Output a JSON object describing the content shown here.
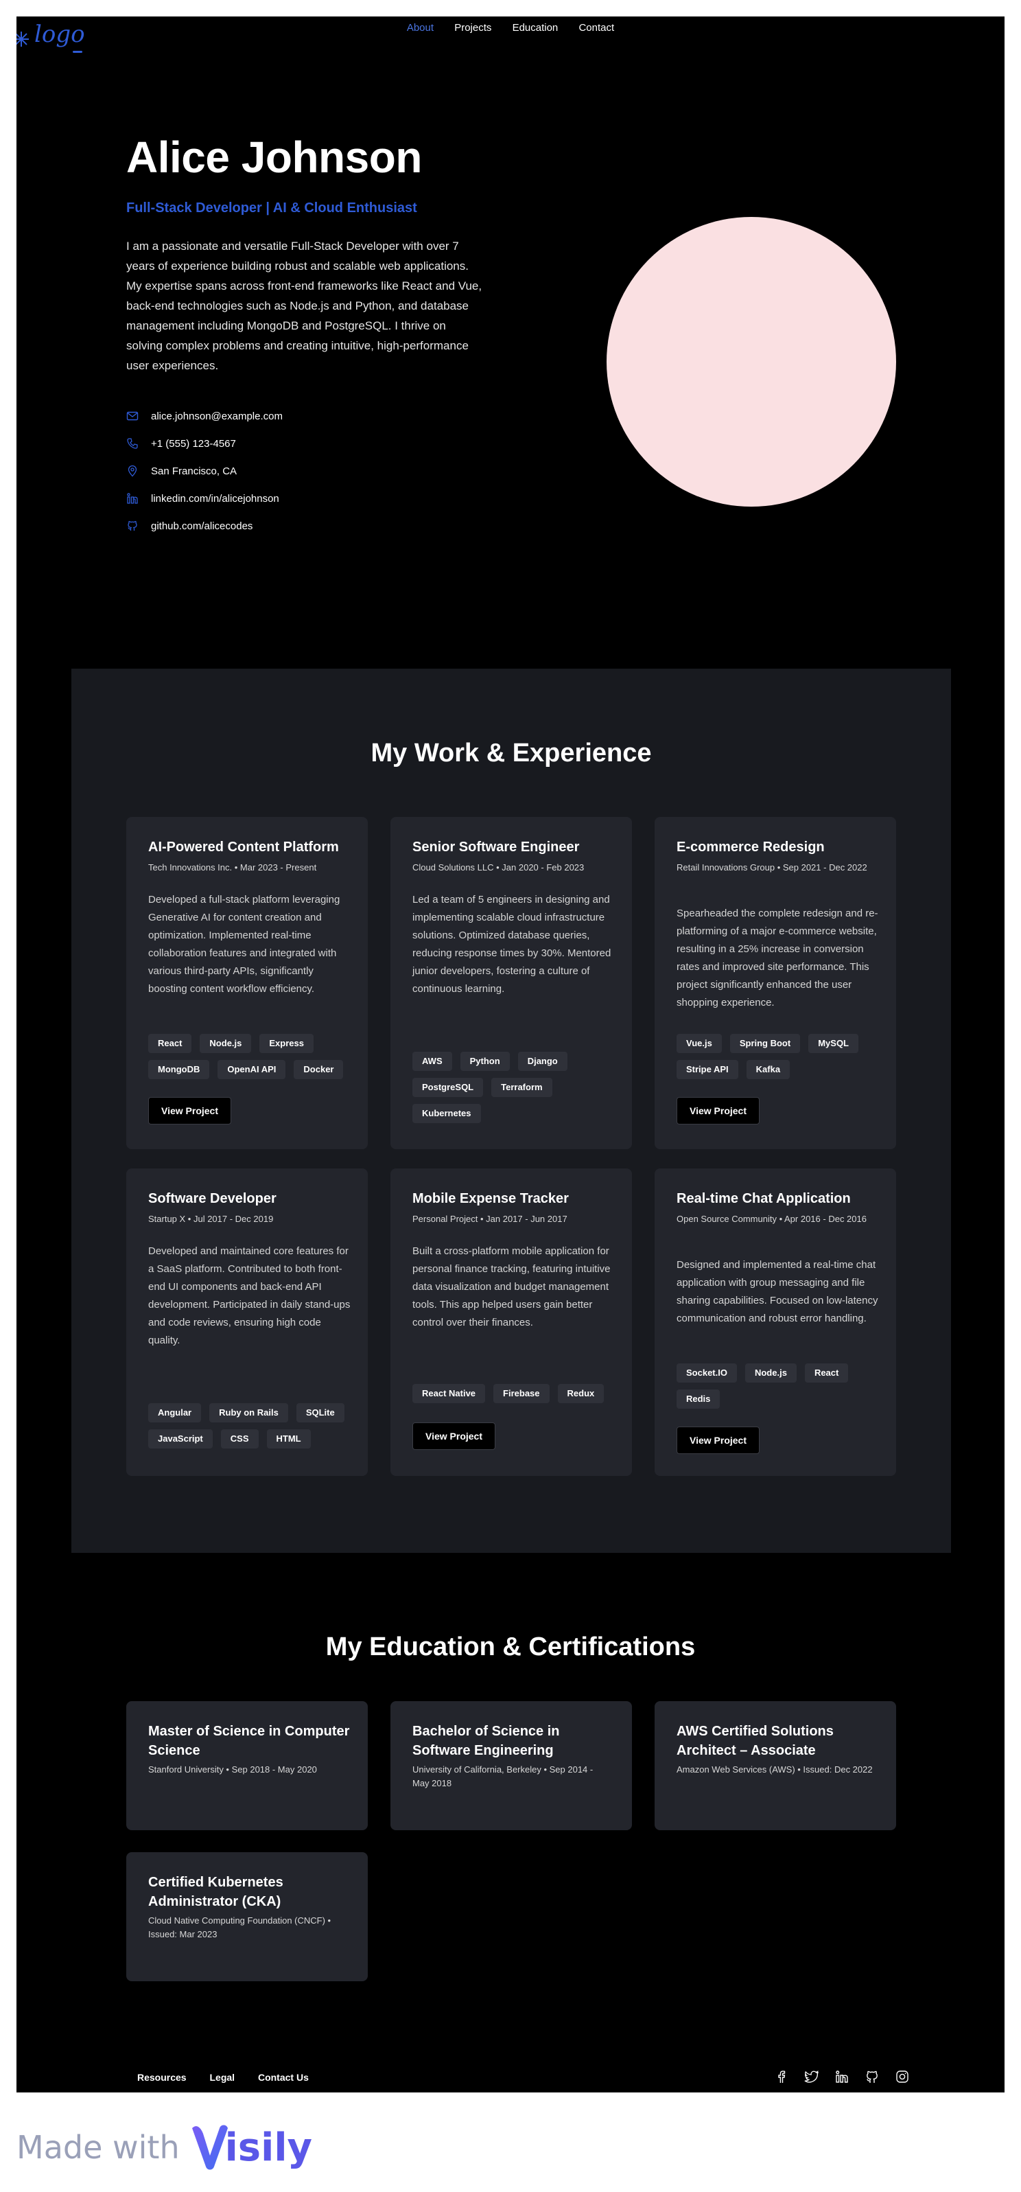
{
  "brand": {
    "logo_text": "logo",
    "logo_color": "#2f5bd6"
  },
  "nav": [
    {
      "label": "About",
      "active": true
    },
    {
      "label": "Projects",
      "active": false
    },
    {
      "label": "Education",
      "active": false
    },
    {
      "label": "Contact",
      "active": false
    }
  ],
  "hero": {
    "name": "Alice Johnson",
    "role": "Full-Stack Developer | AI & Cloud Enthusiast",
    "bio": "I am a passionate and versatile Full-Stack Developer with over 7 years of experience building robust and scalable web applications. My expertise spans across front-end frameworks like React and Vue, back-end technologies such as Node.js and Python, and database management including MongoDB and PostgreSQL. I thrive on solving complex problems and creating intuitive, high-performance user experiences.",
    "contacts": [
      {
        "icon": "mail-icon",
        "text": "alice.johnson@example.com"
      },
      {
        "icon": "phone-icon",
        "text": "+1 (555) 123-4567"
      },
      {
        "icon": "map-pin-icon",
        "text": "San Francisco, CA"
      },
      {
        "icon": "linkedin-icon",
        "text": "linkedin.com/in/alicejohnson"
      },
      {
        "icon": "github-icon",
        "text": "github.com/alicecodes"
      }
    ],
    "avatar_color": "#fae0e2"
  },
  "work": {
    "title": "My Work & Experience",
    "cards": [
      {
        "title": "AI-Powered Content Platform",
        "meta": "Tech Innovations Inc. • Mar 2023 - Present",
        "desc": "Developed a full-stack platform leveraging Generative AI for content creation and optimization. Implemented real-time collaboration features and integrated with various third-party APIs, significantly boosting content workflow efficiency.",
        "tags": [
          "React",
          "Node.js",
          "Express",
          "MongoDB",
          "OpenAI API",
          "Docker"
        ],
        "button": "View Project"
      },
      {
        "title": "Senior Software Engineer",
        "meta": "Cloud Solutions LLC • Jan 2020 - Feb 2023",
        "desc": "Led a team of 5 engineers in designing and implementing scalable cloud infrastructure solutions. Optimized database queries, reducing response times by 30%. Mentored junior developers, fostering a culture of continuous learning.",
        "tags": [
          "AWS",
          "Python",
          "Django",
          "PostgreSQL",
          "Terraform",
          "Kubernetes"
        ],
        "button": ""
      },
      {
        "title": "E-commerce Redesign",
        "meta": "Retail Innovations Group • Sep 2021 - Dec 2022",
        "desc": "Spearheaded the complete redesign and re-platforming of a major e-commerce website, resulting in a 25% increase in conversion rates and improved site performance. This project significantly enhanced the user shopping experience.",
        "tags": [
          "Vue.js",
          "Spring Boot",
          "MySQL",
          "Stripe API",
          "Kafka"
        ],
        "button": "View Project"
      },
      {
        "title": "Software Developer",
        "meta": "Startup X • Jul 2017 - Dec 2019",
        "desc": "Developed and maintained core features for a SaaS platform. Contributed to both front-end UI components and back-end API development. Participated in daily stand-ups and code reviews, ensuring high code quality.",
        "tags": [
          "Angular",
          "Ruby on Rails",
          "SQLite",
          "JavaScript",
          "CSS",
          "HTML"
        ],
        "button": ""
      },
      {
        "title": "Mobile Expense Tracker",
        "meta": "Personal Project • Jan 2017 - Jun 2017",
        "desc": "Built a cross-platform mobile application for personal finance tracking, featuring intuitive data visualization and budget management tools. This app helped users gain better control over their finances.",
        "tags": [
          "React Native",
          "Firebase",
          "Redux"
        ],
        "button": "View Project"
      },
      {
        "title": "Real-time Chat Application",
        "meta": "Open Source Community • Apr 2016 - Dec 2016",
        "desc": "Designed and implemented a real-time chat application with group messaging and file sharing capabilities. Focused on low-latency communication and robust error handling.",
        "tags": [
          "Socket.IO",
          "Node.js",
          "React",
          "Redis"
        ],
        "button": "View Project"
      }
    ]
  },
  "education": {
    "title": "My Education & Certifications",
    "cards": [
      {
        "title": "Master of Science in Computer Science",
        "meta": "Stanford University • Sep 2018 - May 2020"
      },
      {
        "title": "Bachelor of Science in Software Engineering",
        "meta": "University of California, Berkeley • Sep 2014 - May 2018"
      },
      {
        "title": "AWS Certified Solutions Architect – Associate",
        "meta": "Amazon Web Services (AWS) • Issued: Dec 2022"
      },
      {
        "title": "Certified Kubernetes Administrator (CKA)",
        "meta": "Cloud Native Computing Foundation (CNCF) • Issued: Mar 2023"
      }
    ]
  },
  "footer": {
    "links": [
      "Resources",
      "Legal",
      "Contact Us"
    ],
    "socials": [
      "facebook-icon",
      "twitter-icon",
      "linkedin-icon",
      "github-icon",
      "instagram-icon"
    ]
  },
  "badge": {
    "made_with": "Made with",
    "brand": "Visily"
  },
  "colors": {
    "accent": "#2f5bd6",
    "page_bg": "#000000",
    "section_bg": "#181a1f",
    "card_bg": "#23252c"
  }
}
